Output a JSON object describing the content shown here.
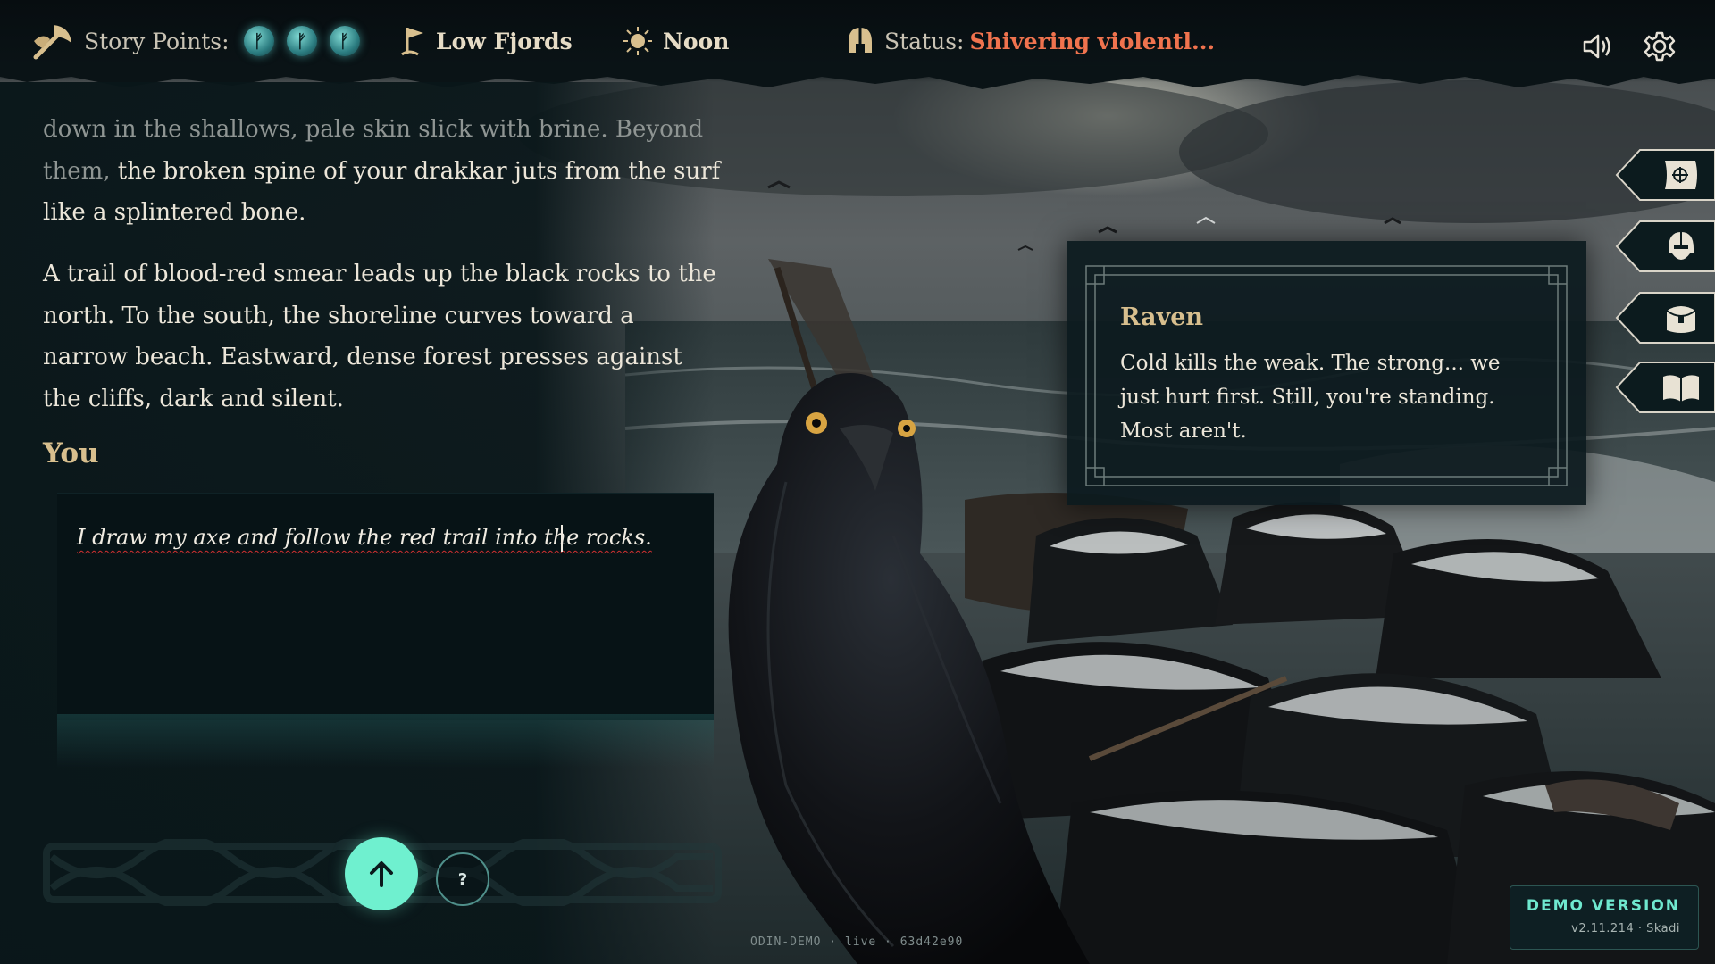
{
  "topbar": {
    "story_points_label": "Story Points:",
    "story_point_rune": "ᚠ",
    "story_points_count": 3,
    "location": "Low Fjords",
    "time_of_day": "Noon",
    "status_label": "Status:",
    "status_value": "Shivering violentl...",
    "icons": [
      "axe-horn-icon",
      "rune-token-icon",
      "flag-icon",
      "sun-icon",
      "helmet-icon",
      "speaker-icon",
      "gear-icon"
    ]
  },
  "narrative": {
    "para1_faded": "down in the shallows, pale skin slick with brine. Beyond them,",
    "para1_rest": "the broken spine of your drakkar juts from the surf like a splintered bone.",
    "para2": "A trail of blood-red smear leads up the black rocks to the north. To the south, the shoreline curves toward a narrow beach. Eastward, dense forest presses against the cliffs, dark and silent.",
    "you_heading": "You"
  },
  "input": {
    "value": "I draw my axe and follow the red trail into the rocks."
  },
  "controls": {
    "help_label": "?"
  },
  "dialogue": {
    "speaker": "Raven",
    "text": "Cold kills the weak. The strong... we just hurt first. Still, you're standing. Most aren't."
  },
  "side_tabs": [
    {
      "name": "map",
      "icon": "map-icon"
    },
    {
      "name": "character",
      "icon": "viking-helmet-icon"
    },
    {
      "name": "inventory",
      "icon": "satchel-icon"
    },
    {
      "name": "journal",
      "icon": "book-icon"
    }
  ],
  "footer": {
    "build_line": "ODIN-DEMO · live · 63d42e90",
    "demo_title": "DEMO VERSION",
    "demo_version": "v2.11.214 · Skadi"
  },
  "colors": {
    "accent_teal": "#6ff0cf",
    "status_orange": "#f0734e",
    "heading_gold": "#d8bf8e",
    "panel_dark": "#091619"
  }
}
